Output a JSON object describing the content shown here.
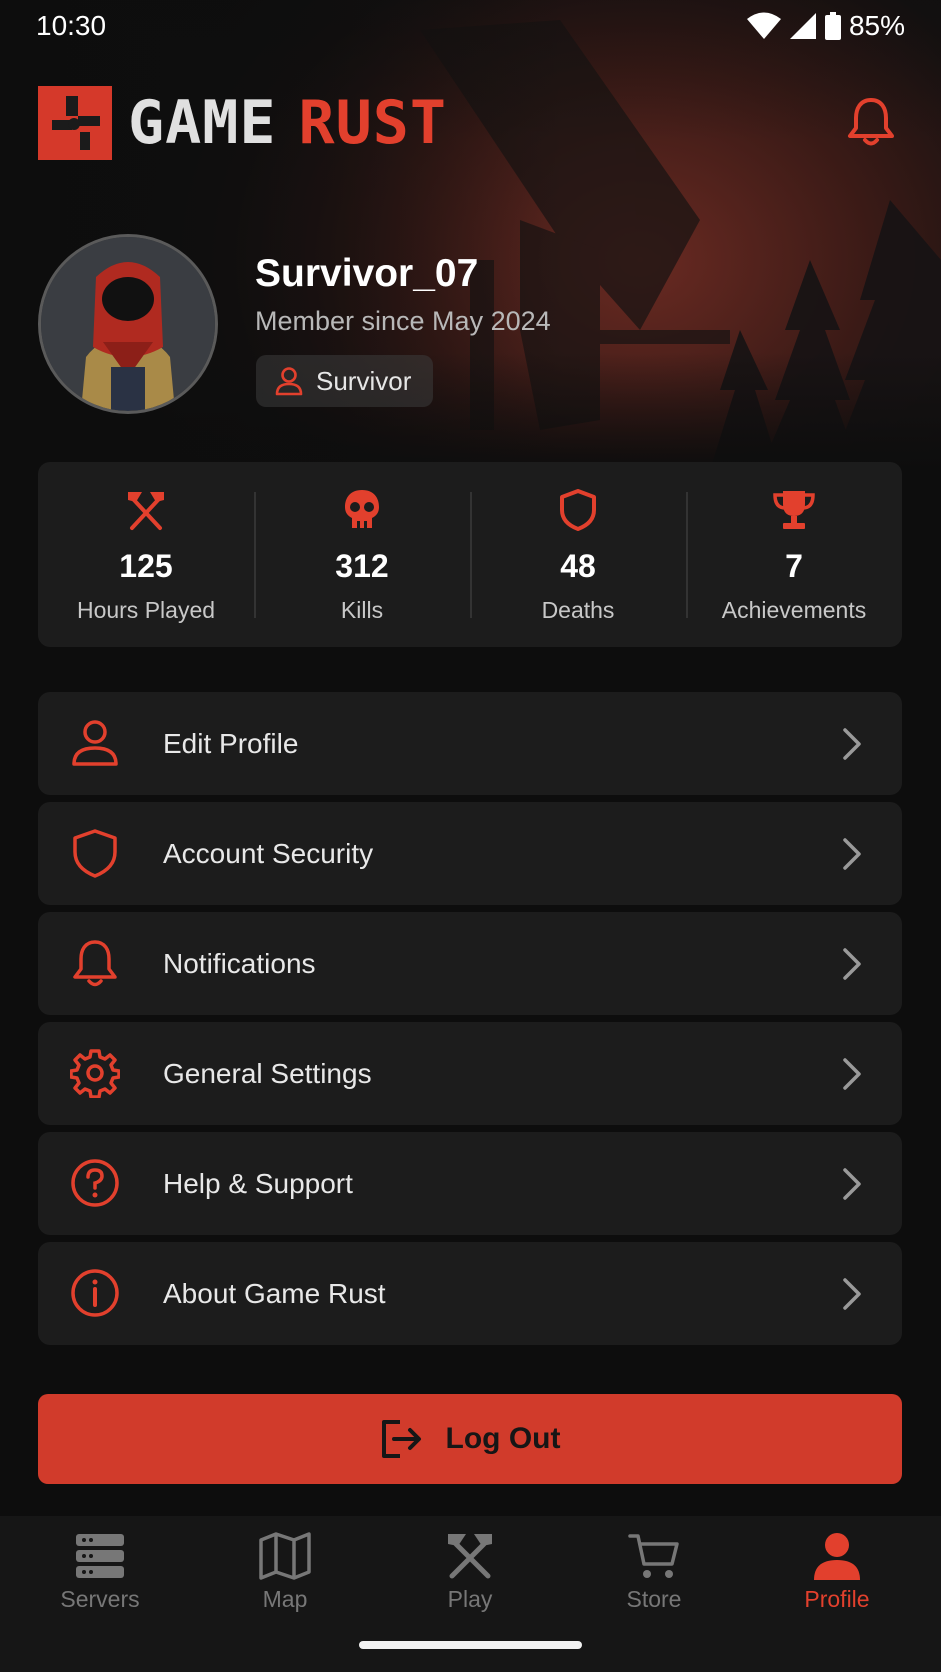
{
  "status_bar": {
    "time": "10:30",
    "battery": "85%"
  },
  "brand": {
    "name_part1": "GAME",
    "name_part2": "RUST"
  },
  "profile": {
    "username": "Survivor_07",
    "member_since": "Member since May 2024",
    "rank": "Survivor"
  },
  "stats": [
    {
      "icon": "crossed-hammers-icon",
      "value": "125",
      "label": "Hours Played"
    },
    {
      "icon": "skull-icon",
      "value": "312",
      "label": "Kills"
    },
    {
      "icon": "shield-icon",
      "value": "48",
      "label": "Deaths"
    },
    {
      "icon": "trophy-icon",
      "value": "7",
      "label": "Achievements"
    }
  ],
  "menu": [
    {
      "icon": "user-icon",
      "label": "Edit Profile"
    },
    {
      "icon": "shield-icon",
      "label": "Account Security"
    },
    {
      "icon": "bell-icon",
      "label": "Notifications"
    },
    {
      "icon": "gear-icon",
      "label": "General Settings"
    },
    {
      "icon": "question-circle-icon",
      "label": "Help & Support"
    },
    {
      "icon": "info-circle-icon",
      "label": "About Game Rust"
    }
  ],
  "logout_label": "Log Out",
  "tabs": [
    {
      "icon": "server-icon",
      "label": "Servers",
      "active": false
    },
    {
      "icon": "map-icon",
      "label": "Map",
      "active": false
    },
    {
      "icon": "crossed-hammers-icon",
      "label": "Play",
      "active": false
    },
    {
      "icon": "cart-icon",
      "label": "Store",
      "active": false
    },
    {
      "icon": "user-icon",
      "label": "Profile",
      "active": true
    }
  ],
  "colors": {
    "accent": "#d5392a",
    "background": "#0d0d0d",
    "card": "#1c1c1c",
    "muted": "#777777"
  }
}
